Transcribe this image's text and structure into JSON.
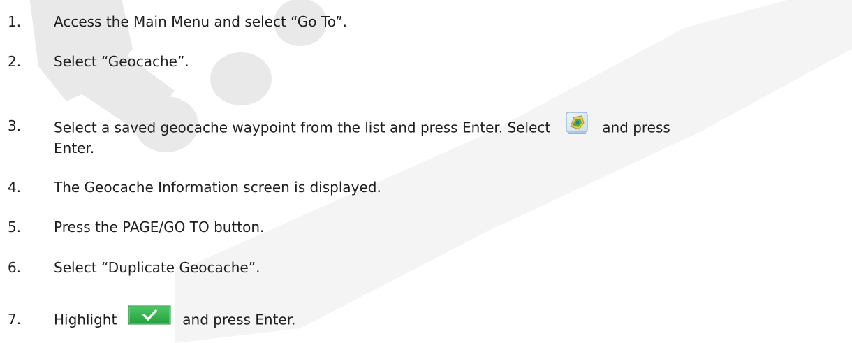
{
  "steps": [
    {
      "number": "1.",
      "text": "Access the Main Menu and select “Go To”."
    },
    {
      "number": "2.",
      "text": "Select “Geocache”."
    },
    {
      "number": "3.",
      "text_before": "Select a saved geocache waypoint from the list and press Enter. Select",
      "icon": "waypoint-map-icon",
      "text_after": "and press",
      "text_line2": "Enter."
    },
    {
      "number": "4.",
      "text": "The Geocache Information screen is displayed."
    },
    {
      "number": "5.",
      "text": "Press the PAGE/GO TO button."
    },
    {
      "number": "6.",
      "text": "Select “Duplicate Geocache”."
    },
    {
      "number": "7.",
      "text_before": "Highlight",
      "icon": "checkmark-button-icon",
      "text_after": "and press Enter."
    }
  ],
  "colors": {
    "text": "#1f1f1f",
    "watermark": "#e6e6e6",
    "checkmark_button": "#2fb34a"
  }
}
